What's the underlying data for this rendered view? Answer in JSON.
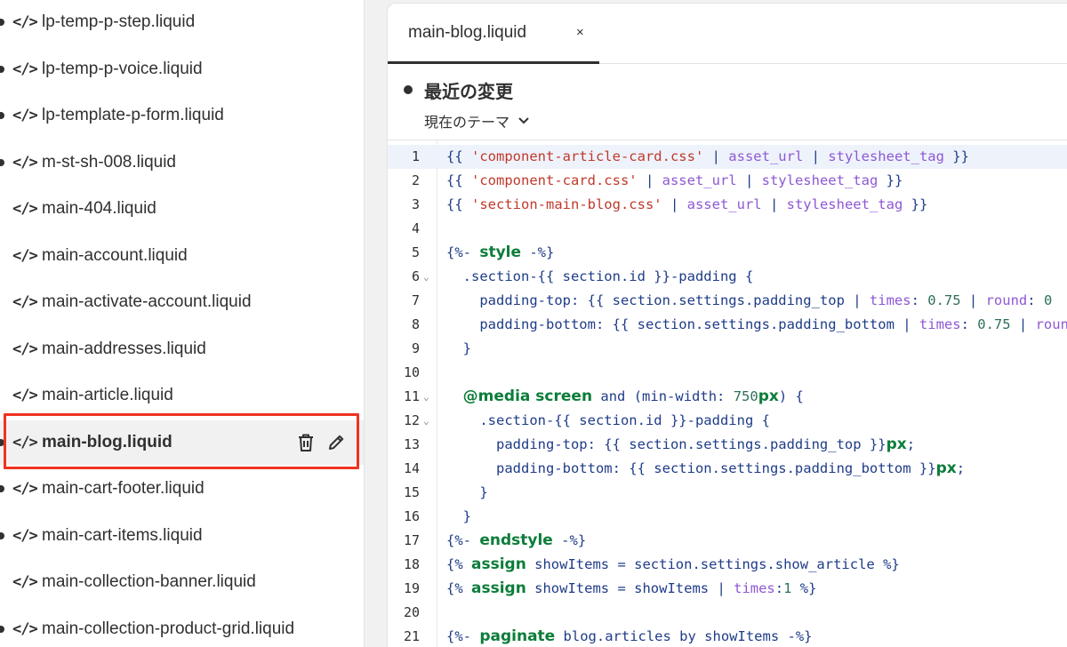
{
  "sidebar": {
    "files": [
      {
        "name": "lp-temp-p-step.liquid",
        "dot": true
      },
      {
        "name": "lp-temp-p-voice.liquid",
        "dot": true
      },
      {
        "name": "lp-template-p-form.liquid",
        "dot": true
      },
      {
        "name": "m-st-sh-008.liquid",
        "dot": true
      },
      {
        "name": "main-404.liquid",
        "dot": false
      },
      {
        "name": "main-account.liquid",
        "dot": false
      },
      {
        "name": "main-activate-account.liquid",
        "dot": false
      },
      {
        "name": "main-addresses.liquid",
        "dot": false
      },
      {
        "name": "main-article.liquid",
        "dot": false
      },
      {
        "name": "main-blog.liquid",
        "dot": true,
        "selected": true
      },
      {
        "name": "main-cart-footer.liquid",
        "dot": true
      },
      {
        "name": "main-cart-items.liquid",
        "dot": true
      },
      {
        "name": "main-collection-banner.liquid",
        "dot": false
      },
      {
        "name": "main-collection-product-grid.liquid",
        "dot": true
      }
    ],
    "icon_glyph": "</>"
  },
  "editor": {
    "tab_label": "main-blog.liquid",
    "tab_close": "×",
    "changes_title": "最近の変更",
    "theme_select": "現在のテーマ",
    "active_line": 1,
    "lines": [
      {
        "n": "1",
        "fold": false
      },
      {
        "n": "2",
        "fold": false
      },
      {
        "n": "3",
        "fold": false
      },
      {
        "n": "4",
        "fold": false
      },
      {
        "n": "5",
        "fold": false
      },
      {
        "n": "6",
        "fold": true
      },
      {
        "n": "7",
        "fold": false
      },
      {
        "n": "8",
        "fold": false
      },
      {
        "n": "9",
        "fold": false
      },
      {
        "n": "10",
        "fold": false
      },
      {
        "n": "11",
        "fold": true
      },
      {
        "n": "12",
        "fold": true
      },
      {
        "n": "13",
        "fold": false
      },
      {
        "n": "14",
        "fold": false
      },
      {
        "n": "15",
        "fold": false
      },
      {
        "n": "16",
        "fold": false
      },
      {
        "n": "17",
        "fold": false
      },
      {
        "n": "18",
        "fold": false
      },
      {
        "n": "19",
        "fold": false
      },
      {
        "n": "20",
        "fold": false
      },
      {
        "n": "21",
        "fold": false
      }
    ],
    "code": [
      [
        [
          "v",
          "{{ "
        ],
        [
          "s",
          "'component-article-card.css'"
        ],
        [
          "v",
          " | "
        ],
        [
          "f",
          "asset_url"
        ],
        [
          "v",
          " | "
        ],
        [
          "f",
          "stylesheet_tag"
        ],
        [
          "v",
          " }}"
        ]
      ],
      [
        [
          "v",
          "{{ "
        ],
        [
          "s",
          "'component-card.css'"
        ],
        [
          "v",
          " | "
        ],
        [
          "f",
          "asset_url"
        ],
        [
          "v",
          " | "
        ],
        [
          "f",
          "stylesheet_tag"
        ],
        [
          "v",
          " }}"
        ]
      ],
      [
        [
          "v",
          "{{ "
        ],
        [
          "s",
          "'section-main-blog.css'"
        ],
        [
          "v",
          " | "
        ],
        [
          "f",
          "asset_url"
        ],
        [
          "v",
          " | "
        ],
        [
          "f",
          "stylesheet_tag"
        ],
        [
          "v",
          " }}"
        ]
      ],
      [],
      [
        [
          "v",
          "{%- "
        ],
        [
          "k",
          "style"
        ],
        [
          "v",
          " -%}"
        ]
      ],
      [
        [
          "v",
          "  .section-{{ section.id }}-padding {"
        ]
      ],
      [
        [
          "v",
          "    padding-top: {{ section.settings.padding_top | "
        ],
        [
          "f",
          "times"
        ],
        [
          "v",
          ": "
        ],
        [
          "n",
          "0.75"
        ],
        [
          "v",
          " | "
        ],
        [
          "f",
          "round"
        ],
        [
          "v",
          ": "
        ],
        [
          "n",
          "0"
        ]
      ],
      [
        [
          "v",
          "    padding-bottom: {{ section.settings.padding_bottom | "
        ],
        [
          "f",
          "times"
        ],
        [
          "v",
          ": "
        ],
        [
          "n",
          "0.75"
        ],
        [
          "v",
          " | "
        ],
        [
          "f",
          "round"
        ]
      ],
      [
        [
          "v",
          "  }"
        ]
      ],
      [],
      [
        [
          "v",
          "  "
        ],
        [
          "k",
          "@media screen"
        ],
        [
          "v",
          " and (min-width: "
        ],
        [
          "n",
          "750"
        ],
        [
          "k",
          "px"
        ],
        [
          "v",
          ") {"
        ]
      ],
      [
        [
          "v",
          "    .section-{{ section.id }}-padding {"
        ]
      ],
      [
        [
          "v",
          "      padding-top: {{ section.settings.padding_top }}"
        ],
        [
          "k",
          "px"
        ],
        [
          "v",
          ";"
        ]
      ],
      [
        [
          "v",
          "      padding-bottom: {{ section.settings.padding_bottom }}"
        ],
        [
          "k",
          "px"
        ],
        [
          "v",
          ";"
        ]
      ],
      [
        [
          "v",
          "    }"
        ]
      ],
      [
        [
          "v",
          "  }"
        ]
      ],
      [
        [
          "v",
          "{%- "
        ],
        [
          "k",
          "endstyle"
        ],
        [
          "v",
          " -%}"
        ]
      ],
      [
        [
          "v",
          "{% "
        ],
        [
          "k",
          "assign"
        ],
        [
          "v",
          " showItems = section.settings.show_article %}"
        ]
      ],
      [
        [
          "v",
          "{% "
        ],
        [
          "k",
          "assign"
        ],
        [
          "v",
          " showItems = showItems | "
        ],
        [
          "f",
          "times"
        ],
        [
          "v",
          ":"
        ],
        [
          "n",
          "1"
        ],
        [
          "v",
          " %}"
        ]
      ],
      [],
      [
        [
          "v",
          "{%- "
        ],
        [
          "k",
          "paginate"
        ],
        [
          "v",
          " blog.articles by showItems -%}"
        ]
      ]
    ]
  }
}
